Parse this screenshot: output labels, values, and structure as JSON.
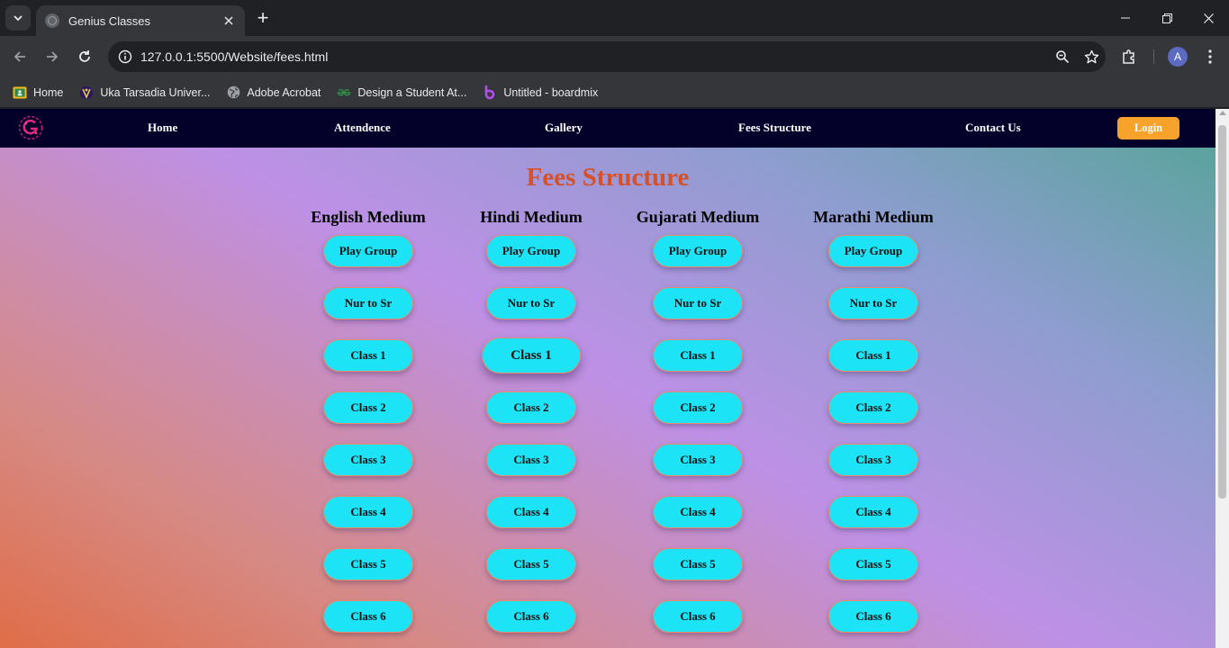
{
  "browser": {
    "tab_title": "Genius Classes",
    "url": "127.0.0.1:5500/Website/fees.html",
    "profile_initial": "A",
    "bookmarks": [
      {
        "label": "Home",
        "icon": "classroom-icon"
      },
      {
        "label": "Uka Tarsadia Univer...",
        "icon": "university-logo-icon"
      },
      {
        "label": "Adobe Acrobat",
        "icon": "globe-icon"
      },
      {
        "label": "Design a Student At...",
        "icon": "geeksforgeeks-icon"
      },
      {
        "label": "Untitled - boardmix",
        "icon": "boardmix-icon"
      }
    ]
  },
  "site": {
    "nav": {
      "home": "Home",
      "attendence": "Attendence",
      "gallery": "Gallery",
      "fees": "Fees Structure",
      "contact": "Contact Us",
      "login": "Login"
    },
    "title": "Fees Structure",
    "columns": [
      {
        "heading": "English Medium",
        "buttons": [
          "Play Group",
          "Nur to Sr",
          "Class 1",
          "Class 2",
          "Class 3",
          "Class 4",
          "Class 5",
          "Class 6"
        ]
      },
      {
        "heading": "Hindi Medium",
        "buttons": [
          "Play Group",
          "Nur to Sr",
          "Class 1",
          "Class 2",
          "Class 3",
          "Class 4",
          "Class 5",
          "Class 6"
        ]
      },
      {
        "heading": "Gujarati Medium",
        "buttons": [
          "Play Group",
          "Nur to Sr",
          "Class 1",
          "Class 2",
          "Class 3",
          "Class 4",
          "Class 5",
          "Class 6"
        ]
      },
      {
        "heading": "Marathi Medium",
        "buttons": [
          "Play Group",
          "Nur to Sr",
          "Class 1",
          "Class 2",
          "Class 3",
          "Class 4",
          "Class 5",
          "Class 6"
        ]
      }
    ]
  },
  "colors": {
    "title": "#d4512a",
    "button_bg": "#1ce3f5",
    "button_border": "#e58d6f",
    "login_bg": "#f7a22b",
    "nav_bg": "#03002a"
  }
}
